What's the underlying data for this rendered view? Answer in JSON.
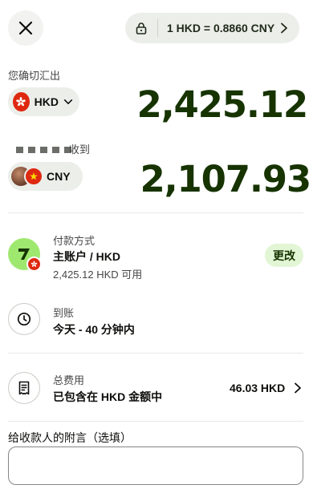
{
  "header": {
    "close_icon": "close-icon",
    "rate": {
      "lock_icon": "lock-icon",
      "text": "1 HKD = 0.8860 CNY",
      "chevron_icon": "chevron-right-icon"
    }
  },
  "send": {
    "label": "您确切汇出",
    "currency": "HKD",
    "flag_icon": "hk-flag-icon",
    "amount": "2,425.12"
  },
  "receive": {
    "label_suffix": "收到",
    "currency": "CNY",
    "flag_icon": "cn-flag-icon",
    "amount": "2,107.93"
  },
  "payment": {
    "caption": "付款方式",
    "title": "主账户 / HKD",
    "sub": "2,425.12 HKD 可用",
    "change_label": "更改"
  },
  "arrival": {
    "caption": "到账",
    "title": "今天 - 40 分钟内",
    "icon": "clock-icon"
  },
  "fees": {
    "caption": "总费用",
    "title": "已包含在 HKD 金额中",
    "amount": "46.03 HKD",
    "icon": "receipt-icon"
  },
  "note": {
    "label": "给收款人的附言（选填）",
    "value": ""
  },
  "colors": {
    "brand_green": "#9fe870",
    "amount_green": "#163300",
    "pill_bg": "#eceee9"
  }
}
